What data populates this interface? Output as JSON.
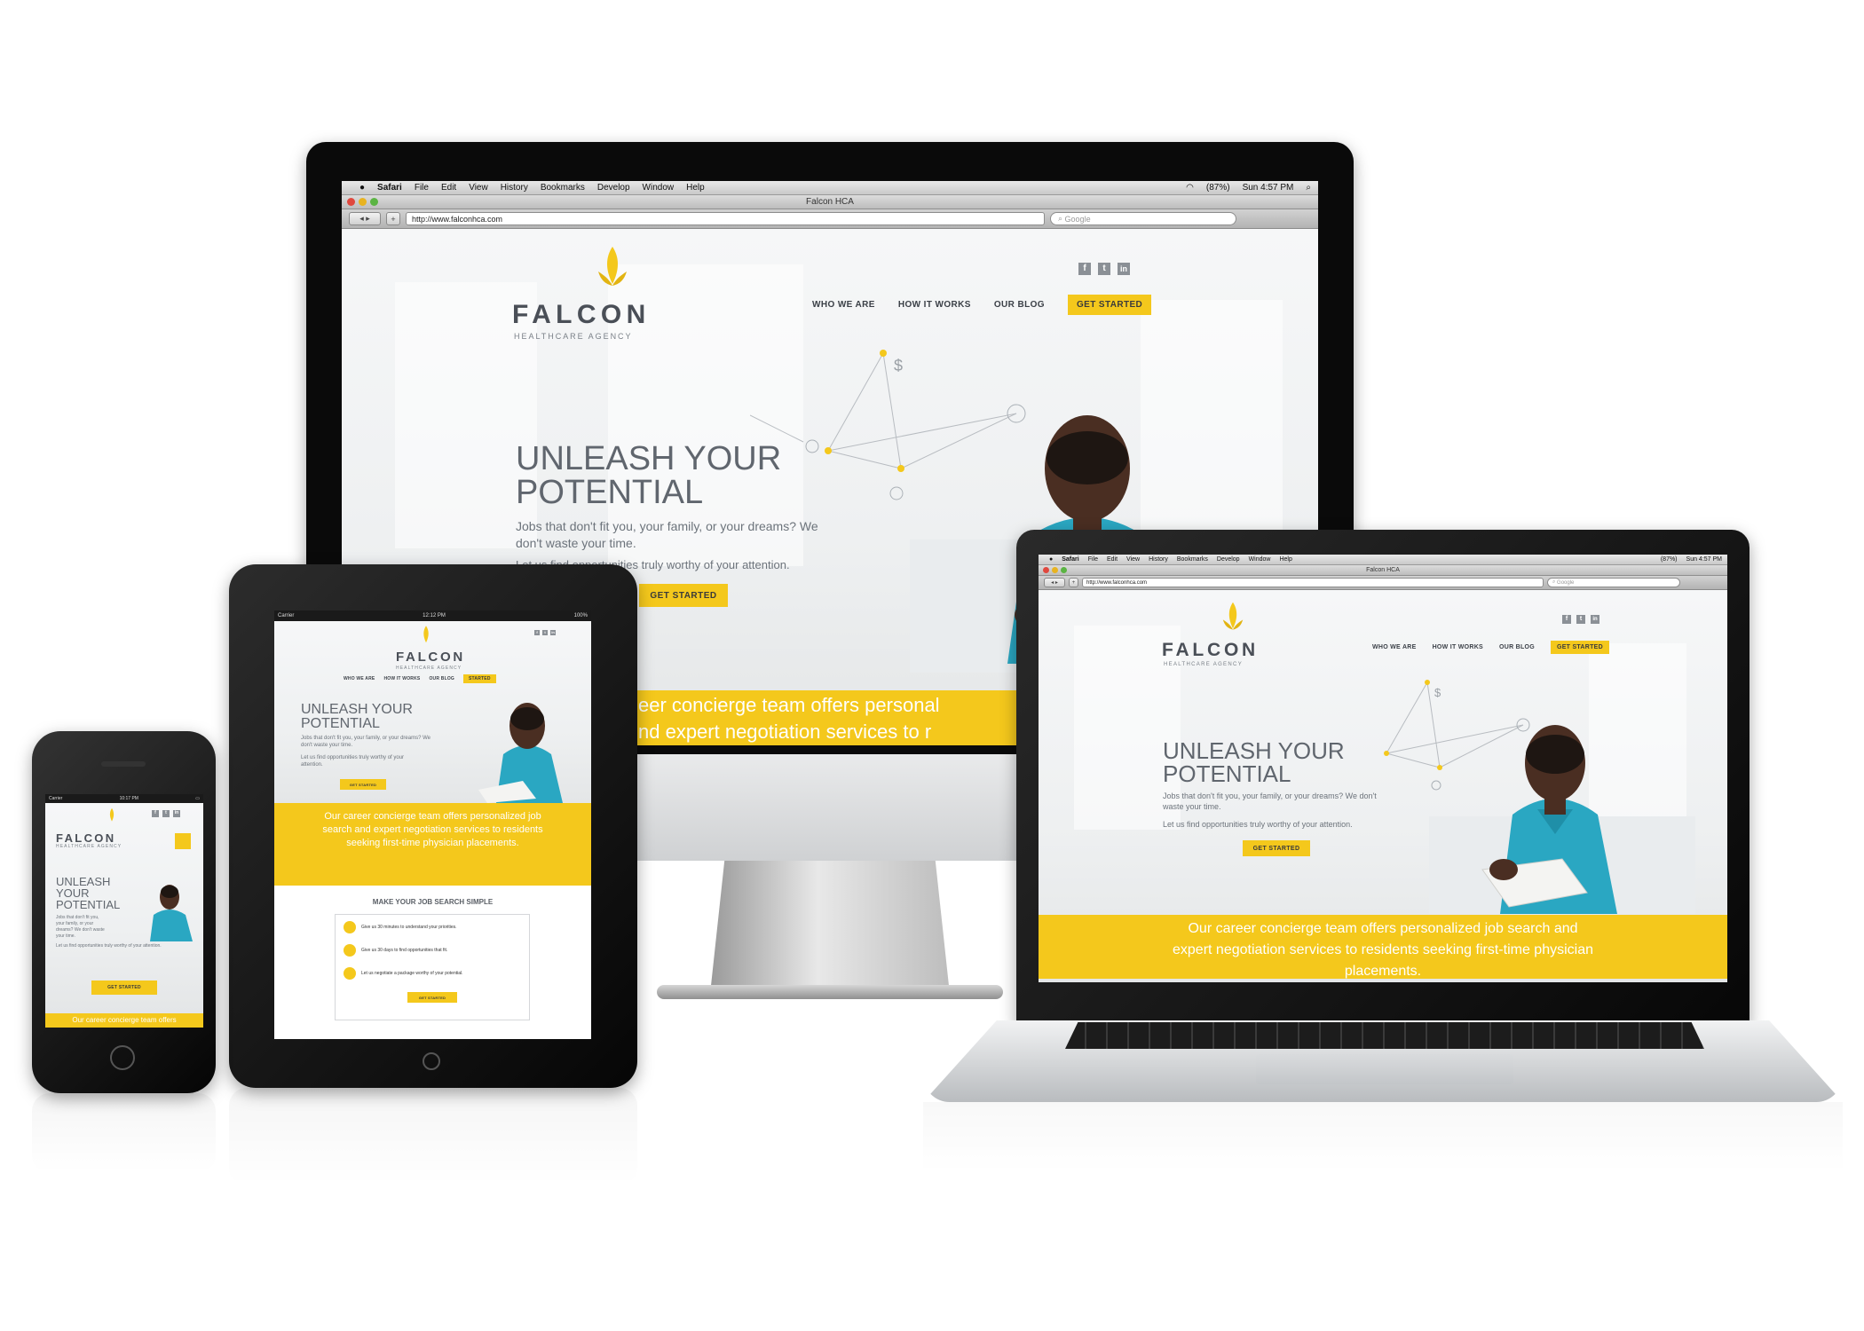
{
  "mac_menu": {
    "app": "Safari",
    "items": [
      "File",
      "Edit",
      "View",
      "History",
      "Bookmarks",
      "Develop",
      "Window",
      "Help"
    ],
    "battery": "(87%)",
    "clock": "Sun 4:57 PM"
  },
  "browser": {
    "title": "Falcon HCA",
    "url": "http://www.falconhca.com",
    "search_placeholder": "Google"
  },
  "site": {
    "logo_word": "FALCON",
    "logo_sub": "HEALTHCARE AGENCY",
    "nav": [
      "WHO WE ARE",
      "HOW IT WORKS",
      "OUR BLOG"
    ],
    "cta": "GET STARTED",
    "headline_1": "UNLEASH YOUR",
    "headline_2": "POTENTIAL",
    "tagline": "Jobs that don't fit you, your family, or your dreams? We don't waste your time.",
    "tagline2": "Let us find opportunities truly worthy of your attention.",
    "button": "GET STARTED",
    "band_full": "Our career concierge team offers personalized job search and expert negotiation services to residents seeking first-time physician placements.",
    "band_desktop_l1": "eer concierge team offers personal",
    "band_desktop_l2": "nd expert negotiation services to r",
    "band_phone": "Our career concierge team offers",
    "dollar": "$"
  },
  "social_icons": [
    "facebook-icon",
    "twitter-icon",
    "linkedin-icon"
  ],
  "tablet": {
    "status_left": "Carrier",
    "status_time": "12:12 PM",
    "status_right": "100%",
    "cta_partial": "STARTED",
    "section_title": "MAKE YOUR JOB SEARCH SIMPLE",
    "steps": [
      "Give us 30 minutes to understand your priorities.",
      "Give us 30 days to find opportunities that fit.",
      "Let us negotiate a package worthy of your potential."
    ]
  },
  "phone": {
    "status_left": "Carrier",
    "status_time": "10:17 PM",
    "headline_1": "UNLEASH",
    "headline_2": "YOUR",
    "headline_3": "POTENTIAL",
    "tagline_l1": "Jobs that don't fit you,",
    "tagline_l2": "your family, or your",
    "tagline_l3": "dreams? We don't waste",
    "tagline_l4": "your time."
  },
  "colors": {
    "accent": "#f4c81c",
    "scrubs": "#2aa7c2",
    "text": "#60666e"
  }
}
